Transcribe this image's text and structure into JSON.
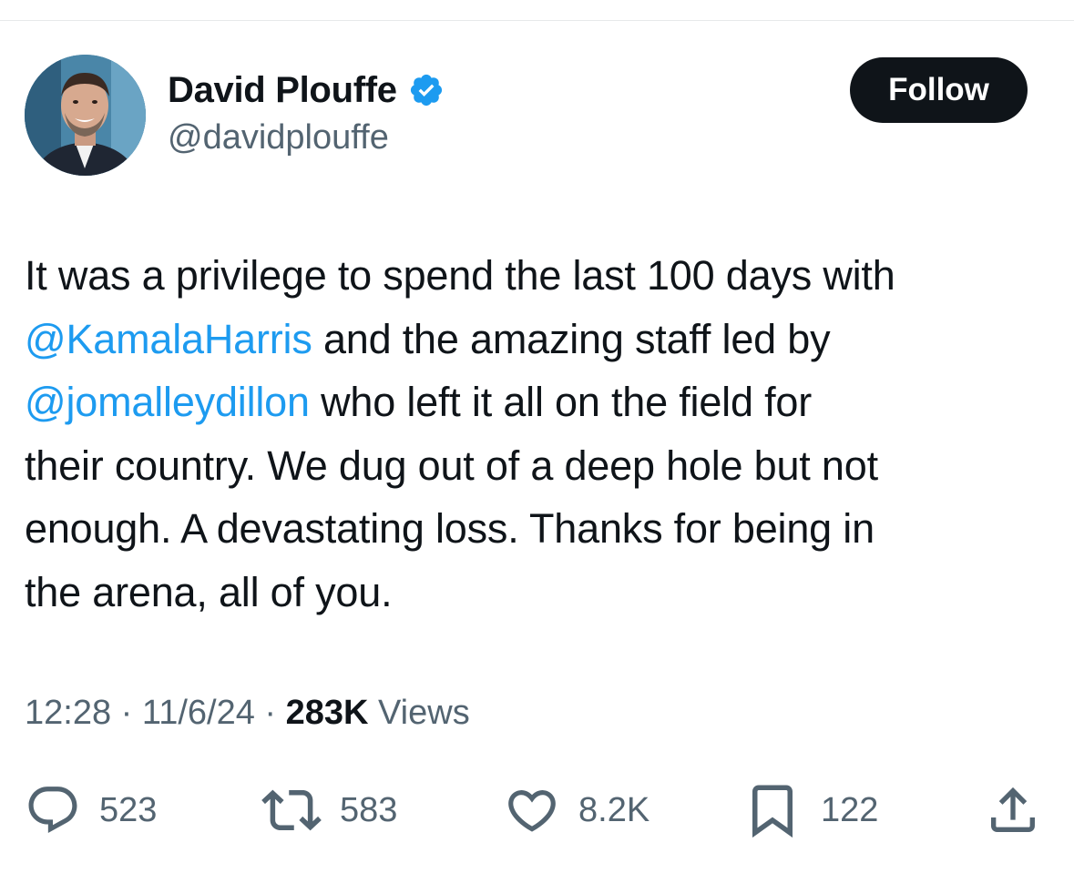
{
  "author": {
    "display_name": "David Plouffe",
    "handle": "@davidplouffe",
    "verified": true
  },
  "follow_button": {
    "label": "Follow"
  },
  "tweet": {
    "lines": [
      [
        {
          "text": "It was a privilege to spend the last 100 days with",
          "mention": false
        }
      ],
      [
        {
          "text": "@KamalaHarris",
          "mention": true
        },
        {
          "text": " and the amazing staff led by",
          "mention": false
        }
      ],
      [
        {
          "text": "@jomalleydillon",
          "mention": true
        },
        {
          "text": " who left it all on the field for",
          "mention": false
        }
      ],
      [
        {
          "text": "their country. We dug out of a deep hole but not",
          "mention": false
        }
      ],
      [
        {
          "text": "enough. A devastating loss. Thanks for being in",
          "mention": false
        }
      ],
      [
        {
          "text": "the arena, all of you.",
          "mention": false
        }
      ]
    ]
  },
  "meta": {
    "time": "12:28",
    "separator": " · ",
    "date": "11/6/24",
    "views_count": "283K",
    "views_label": " Views"
  },
  "actions": {
    "replies": "523",
    "reposts": "583",
    "likes": "8.2K",
    "bookmarks": "122"
  },
  "colors": {
    "text": "#0f1419",
    "secondary": "#536471",
    "link": "#1d9bf0",
    "verified": "#1d9bf0",
    "follow_bg": "#0f1419"
  }
}
